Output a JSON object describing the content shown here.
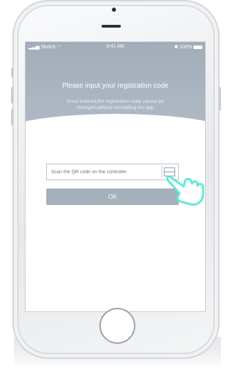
{
  "status_bar": {
    "carrier": "Sketch",
    "time": "9:41 AM",
    "battery": "100%"
  },
  "header": {
    "title": "Please input your registration code",
    "subtitle": "Once entered,the registration code cannot be changed without reinstalling the app"
  },
  "form": {
    "code_placeholder": "Scan the QR code on the controller.",
    "ok_label": "OK",
    "scan_icon": "qr-scan-icon"
  },
  "decor": {
    "hand_icon": "hand-pointer-icon",
    "accent_color": "#5ee8d6"
  }
}
